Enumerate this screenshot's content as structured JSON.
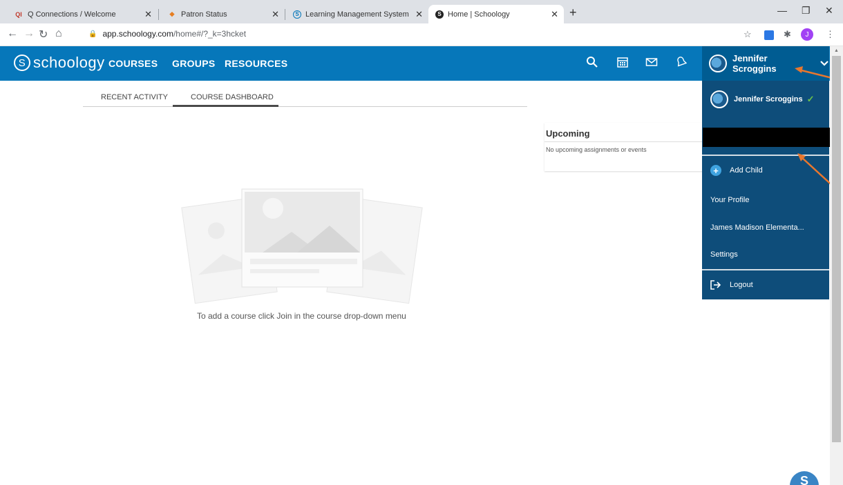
{
  "browser": {
    "tabs": [
      {
        "title": "Q Connections / Welcome",
        "icon": "qc-favicon"
      },
      {
        "title": "Patron Status",
        "icon": "patron-favicon"
      },
      {
        "title": "Learning Management System | ",
        "icon": "schoology-favicon"
      },
      {
        "title": "Home | Schoology",
        "icon": "schoology-favicon"
      }
    ],
    "url_host": "app.schoology.com",
    "url_path": "/home#/?_k=3hcket",
    "profile_initial": "J"
  },
  "header": {
    "logo_text": "schoology",
    "nav": [
      "COURSES",
      "GROUPS",
      "RESOURCES"
    ],
    "user_name": "Jennifer Scroggins",
    "brand_color": "#0677ba"
  },
  "subtabs": [
    "RECENT ACTIVITY",
    "COURSE DASHBOARD"
  ],
  "upcoming": {
    "title": "Upcoming",
    "empty_text": "No upcoming assignments or events"
  },
  "main": {
    "empty_message": "To add a course click Join in the course drop-down menu"
  },
  "dropdown": {
    "current_user": "Jennifer Scroggins",
    "add_child": "Add Child",
    "profile": "Your Profile",
    "school": "James Madison Elementa...",
    "settings": "Settings",
    "logout": "Logout"
  },
  "fab_label": "S"
}
